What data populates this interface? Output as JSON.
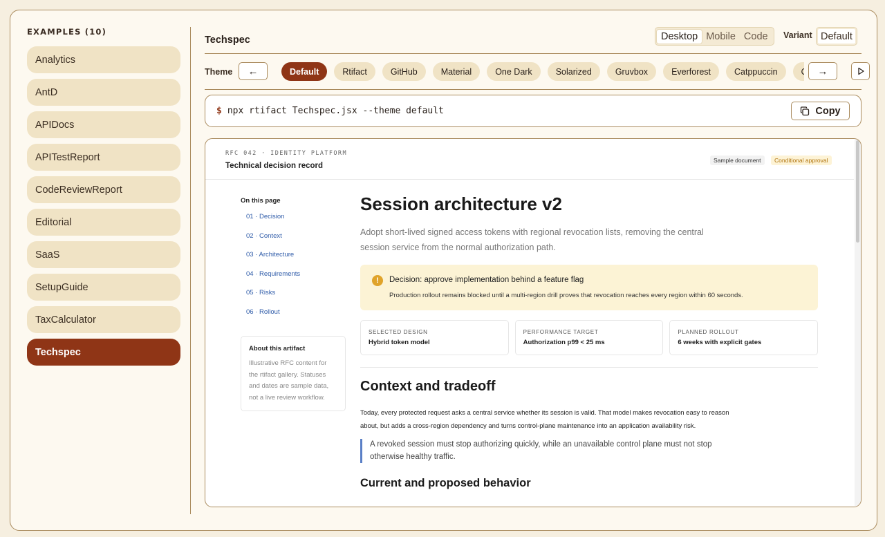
{
  "sidebar": {
    "title": "EXAMPLES (10)",
    "items": [
      {
        "label": "Analytics"
      },
      {
        "label": "AntD"
      },
      {
        "label": "APIDocs"
      },
      {
        "label": "APITestReport"
      },
      {
        "label": "CodeReviewReport"
      },
      {
        "label": "Editorial"
      },
      {
        "label": "SaaS"
      },
      {
        "label": "SetupGuide"
      },
      {
        "label": "TaxCalculator"
      },
      {
        "label": "Techspec",
        "active": true
      }
    ]
  },
  "header": {
    "title": "Techspec",
    "view_modes": [
      "Desktop",
      "Mobile",
      "Code"
    ],
    "selected_view": "Desktop",
    "variant_label": "Variant",
    "variant_value": "Default"
  },
  "theme_bar": {
    "label": "Theme",
    "prev_icon": "arrow-left-icon",
    "next_icon": "arrow-right-icon",
    "play_icon": "play-icon",
    "themes": [
      "Default",
      "Rtifact",
      "GitHub",
      "Material",
      "One Dark",
      "Solarized",
      "Gruvbox",
      "Everforest",
      "Catppuccin",
      "Obsidian"
    ],
    "selected": "Default"
  },
  "command": {
    "prompt": "$",
    "text": "npx rtifact Techspec.jsx --theme default",
    "copy_label": "Copy",
    "copy_icon": "copy-icon"
  },
  "preview": {
    "rfc_code": "RFC 042 · IDENTITY PLATFORM",
    "rfc_title": "Technical decision record",
    "badge_sample": "Sample document",
    "badge_status": "Conditional approval",
    "toc_title": "On this page",
    "toc": [
      "01 · Decision",
      "02 · Context",
      "03 · Architecture",
      "04 · Requirements",
      "05 · Risks",
      "06 · Rollout"
    ],
    "about_title": "About this artifact",
    "about_text": "Illustrative RFC content for the rtifact gallery. Statuses and dates are sample data, not a live review workflow.",
    "h1": "Session architecture v2",
    "lede": "Adopt short-lived signed access tokens with regional revocation lists, removing the central session service from the normal authorization path.",
    "callout_icon": "warning-icon",
    "callout_title": "Decision: approve implementation behind a feature flag",
    "callout_text": "Production rollout remains blocked until a multi-region drill proves that revocation reaches every region within 60 seconds.",
    "stats": [
      {
        "label": "SELECTED DESIGN",
        "value": "Hybrid token model"
      },
      {
        "label": "PERFORMANCE TARGET",
        "value": "Authorization p99 < 25 ms"
      },
      {
        "label": "PLANNED ROLLOUT",
        "value": "6 weeks with explicit gates"
      }
    ],
    "h2": "Context and tradeoff",
    "body": "Today, every protected request asks a central service whether its session is valid. That model makes revocation easy to reason about, but adds a cross-region dependency and turns control-plane maintenance into an application availability risk.",
    "quote": "A revoked session must stop authorizing quickly, while an unavailable control plane must not stop otherwise healthy traffic.",
    "h3": "Current and proposed behavior"
  },
  "colors": {
    "accent": "#8f3516",
    "chip": "#f0e3c5",
    "border": "#a98a5c",
    "link": "#2d5aa8",
    "callout_bg": "#fcf3d5"
  }
}
